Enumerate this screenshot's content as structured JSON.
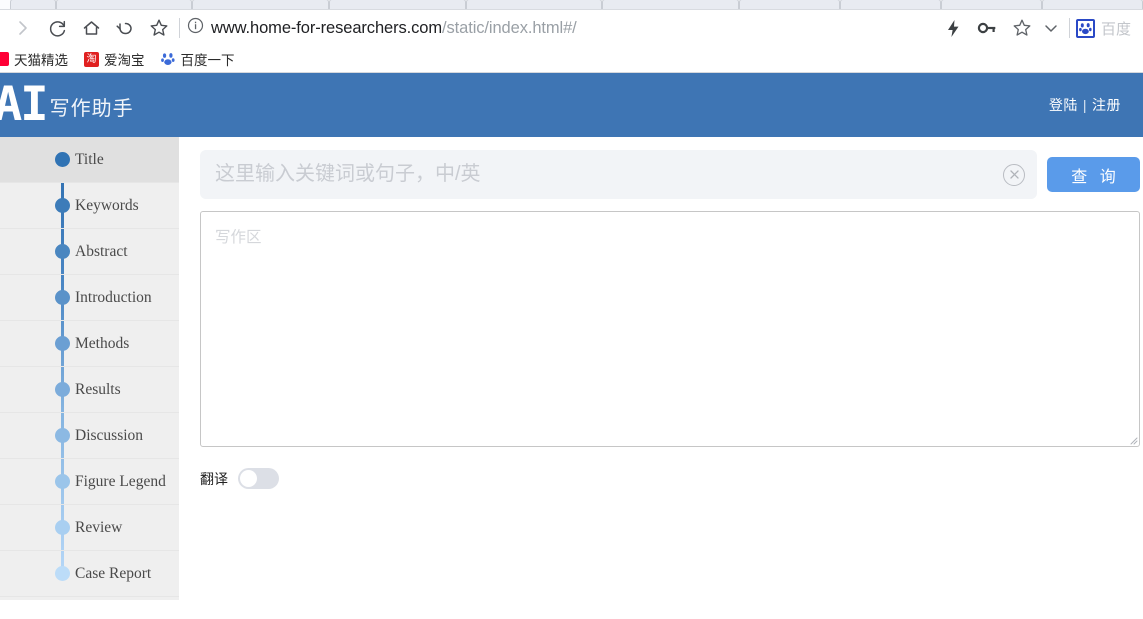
{
  "browser": {
    "tabs_visible": 10,
    "nav_icons": [
      {
        "name": "forward-icon",
        "glyph": "chevron-right"
      },
      {
        "name": "reload-icon",
        "glyph": "reload"
      },
      {
        "name": "home-icon",
        "glyph": "home"
      },
      {
        "name": "undo-icon",
        "glyph": "undo-arrow"
      },
      {
        "name": "bookmark-star-icon",
        "glyph": "star"
      }
    ],
    "site_info_icon": "info-circle-icon",
    "url": {
      "domain": "www.home-for-researchers.com",
      "path": "/static/index.html#/"
    },
    "right_icons": [
      {
        "name": "lightning-icon",
        "glyph": "lightning-bolt"
      },
      {
        "name": "key-icon",
        "glyph": "key"
      },
      {
        "name": "favorite-star-icon",
        "glyph": "star"
      },
      {
        "name": "chevron-down-icon",
        "glyph": "chevron-down"
      }
    ],
    "baidu_chip": {
      "icon": "baidu-paw-icon",
      "label": "百度"
    },
    "bookmarks": [
      {
        "label": "天猫精选",
        "icon": "tmall-icon"
      },
      {
        "label": "爱淘宝",
        "icon": "taobao-icon",
        "icon_text": "淘"
      },
      {
        "label": "百度一下",
        "icon": "baidu-paw-icon"
      }
    ]
  },
  "app": {
    "header": {
      "logo_main": "AI",
      "logo_sub": "写作助手",
      "login_label": "登陆",
      "separator": "|",
      "register_label": "注册",
      "background_color": "#3e75b4"
    },
    "sidebar": {
      "background_color": "#efefef",
      "active_background_color": "#e0e0e0",
      "items": [
        {
          "label": "Title",
          "dot_color": "#3073b4",
          "active": true
        },
        {
          "label": "Keywords",
          "dot_color": "#3d7cb9",
          "active": false
        },
        {
          "label": "Abstract",
          "dot_color": "#4a86c0",
          "active": false
        },
        {
          "label": "Introduction",
          "dot_color": "#5a92c9",
          "active": false
        },
        {
          "label": "Methods",
          "dot_color": "#6b9fd3",
          "active": false
        },
        {
          "label": "Results",
          "dot_color": "#7cacdb",
          "active": false
        },
        {
          "label": "Discussion",
          "dot_color": "#8cb9e3",
          "active": false
        },
        {
          "label": "Figure Legend",
          "dot_color": "#9bc5ea",
          "active": false
        },
        {
          "label": "Review",
          "dot_color": "#a9cff1",
          "active": false
        },
        {
          "label": "Case Report",
          "dot_color": "#bcdcf8",
          "active": false
        }
      ]
    },
    "search": {
      "placeholder": "这里输入关键词或句子，中/英",
      "value": "",
      "clear_icon": "clear-circle-icon",
      "button_label": "查 询",
      "button_color": "#5a9bea"
    },
    "editor": {
      "placeholder": "写作区",
      "value": ""
    },
    "translate": {
      "label": "翻译",
      "enabled": false
    }
  }
}
